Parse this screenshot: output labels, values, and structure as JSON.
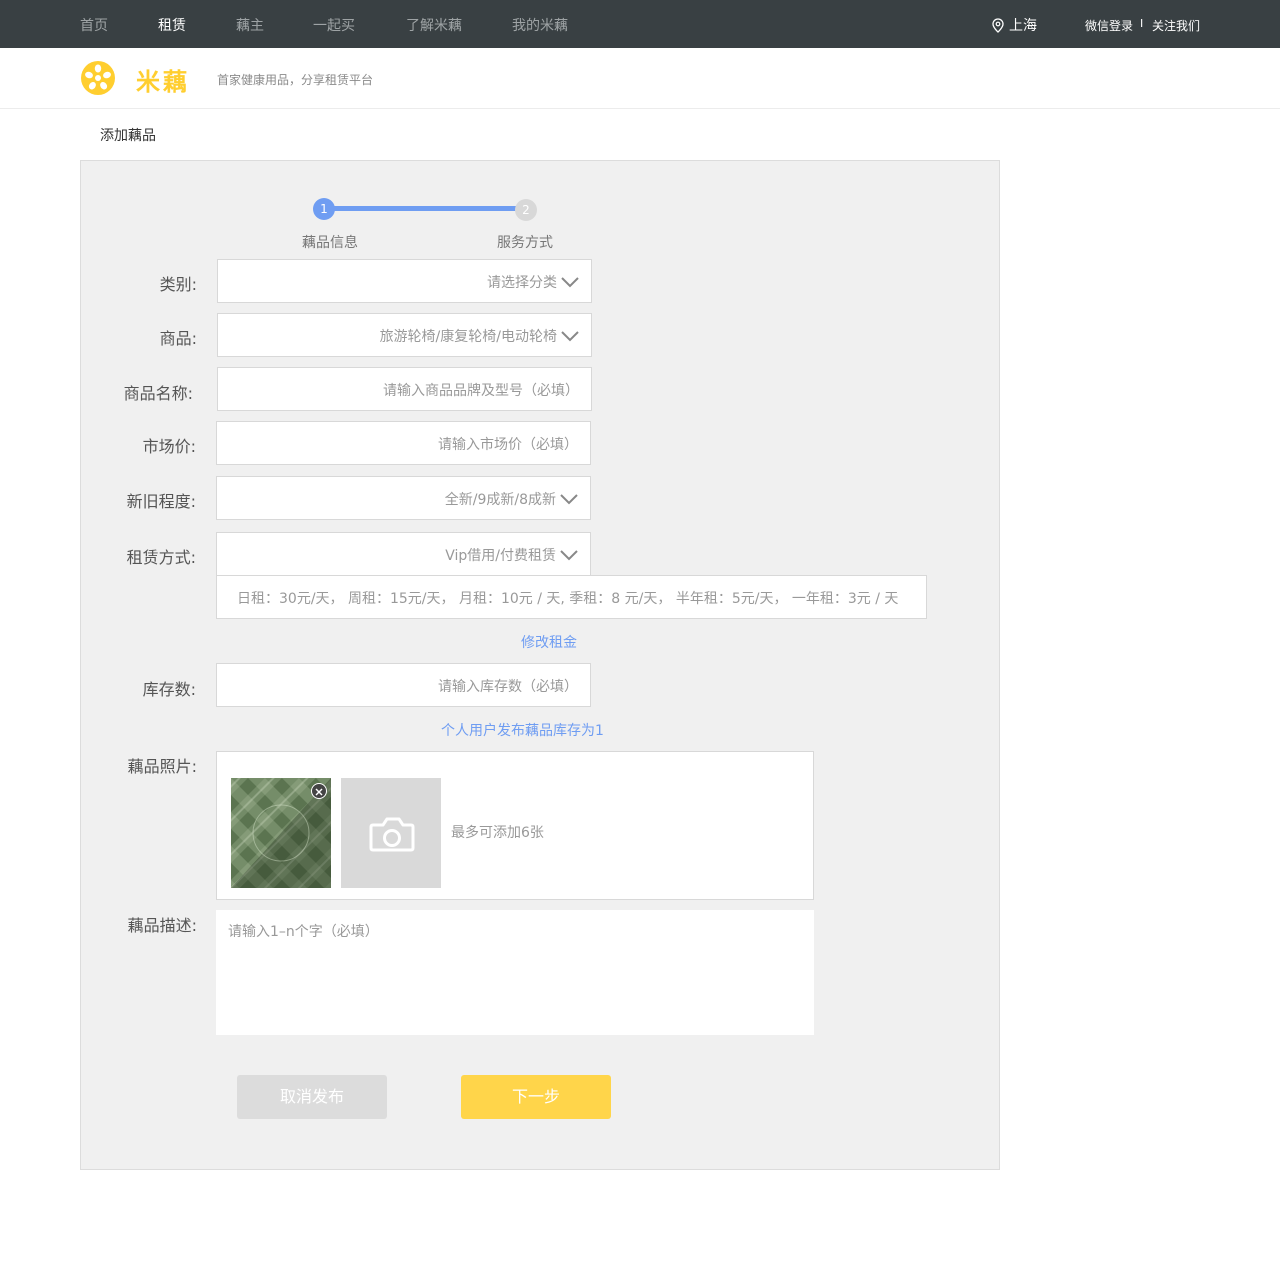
{
  "nav": {
    "items": [
      "首页",
      "租赁",
      "藕主",
      "一起买",
      "了解米藕",
      "我的米藕"
    ],
    "city": "上海",
    "login": "微信登录",
    "separator": "I",
    "follow": "关注我们"
  },
  "brand": {
    "name": "米藕",
    "slogan": "首家健康用品，分享租赁平台",
    "accent_color": "#ffce2f"
  },
  "page": {
    "title": "添加藕品"
  },
  "steps": [
    {
      "number": "1",
      "label": "藕品信息",
      "state": "active"
    },
    {
      "number": "2",
      "label": "服务方式",
      "state": "inactive"
    }
  ],
  "form": {
    "category": {
      "label": "类别:",
      "value": "请选择分类"
    },
    "product": {
      "label": "商品:",
      "value": "旅游轮椅/康复轮椅/电动轮椅"
    },
    "name": {
      "label": "商品名称:",
      "placeholder": "请输入商品品牌及型号（必填）"
    },
    "market_price": {
      "label": "市场价:",
      "placeholder": "请输入市场价（必填）"
    },
    "condition": {
      "label": "新旧程度:",
      "value": "全新/9成新/8成新"
    },
    "rent_mode": {
      "label": "租赁方式:",
      "value": "Vip借用/付费租赁"
    },
    "rent_prices": "日租：30元/天，  周租：15元/天，  月租：10元 / 天, 季租：8 元/天， 半年租：5元/天， 一年租：3元 / 天",
    "edit_rent_link": "修改租金",
    "stock": {
      "label": "库存数:",
      "placeholder": "请输入库存数（必填）"
    },
    "stock_hint": "个人用户发布藕品库存为1",
    "photos": {
      "label": "藕品照片:",
      "hint": "最多可添加6张"
    },
    "description": {
      "label": "藕品描述:",
      "placeholder": "请输入1–n个字（必填）"
    }
  },
  "buttons": {
    "cancel": "取消发布",
    "next": "下一步"
  },
  "colors": {
    "topbar": "#394043",
    "blue": "#6f9df2",
    "yellow": "#ffd54a",
    "panel": "#f0f0f0"
  }
}
